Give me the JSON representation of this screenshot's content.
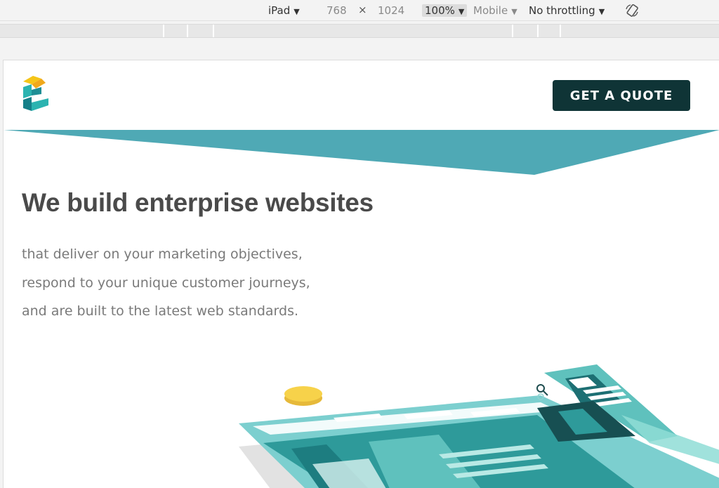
{
  "devtools": {
    "device": "iPad",
    "width": "768",
    "times": "×",
    "height": "1024",
    "zoom": "100%",
    "network_profile": "Mobile",
    "throttling": "No throttling"
  },
  "site": {
    "cta_label": "GET A QUOTE",
    "hero_title": "We build enterprise websites",
    "hero_lines": [
      "that deliver on your marketing objectives,",
      "respond to your unique customer journeys,",
      "and are built to the latest web standards."
    ]
  },
  "colors": {
    "banner_teal": "#4fa9b5",
    "cta_dark": "#0f3436",
    "logo_yellow": "#f5c518",
    "logo_teal": "#2bb3b0",
    "coin_yellow": "#f7d24a"
  },
  "icons": [
    "caret-down-icon",
    "rotate-icon",
    "logo-icon",
    "magnifier-icon"
  ]
}
